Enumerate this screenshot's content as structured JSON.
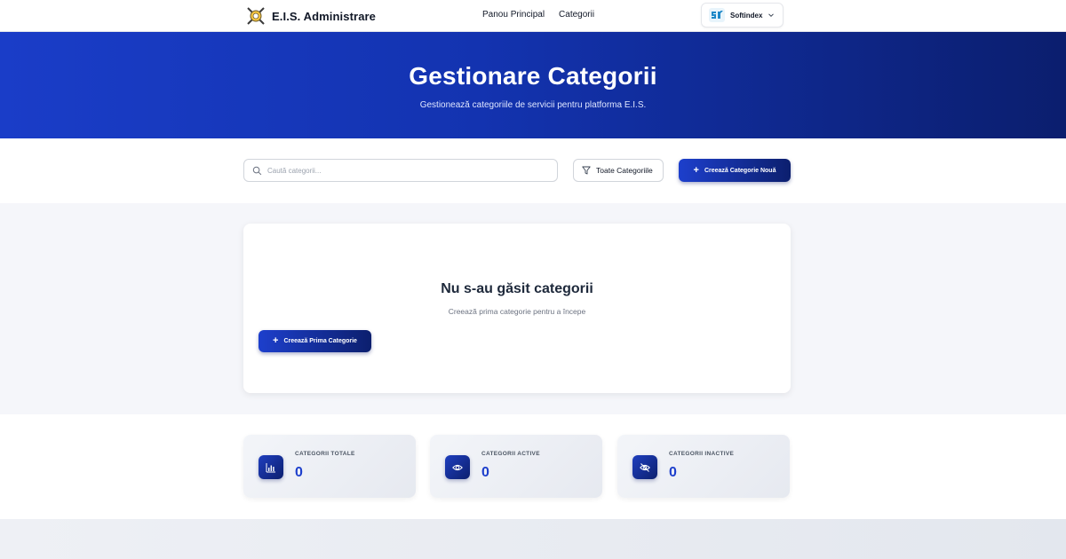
{
  "nav": {
    "brand_name": "E.I.S. Administrare",
    "brand_icon": "crossed-tools-logo-icon",
    "links": [
      {
        "label": "Panou Principal"
      },
      {
        "label": "Categorii"
      }
    ],
    "company": {
      "name": "Softindex",
      "logo_icon": "softindex-logo-icon"
    }
  },
  "hero": {
    "title": "Gestionare Categorii",
    "subtitle": "Gestionează categoriile de servicii pentru platforma E.I.S."
  },
  "toolbar": {
    "search": {
      "placeholder": "Caută categorii...",
      "value": ""
    },
    "filter": {
      "selected": "Toate Categoriile"
    },
    "create_button": "Creează Categorie Nouă"
  },
  "empty_state": {
    "title": "Nu s-au găsit categorii",
    "subtitle": "Creează prima categorie pentru a începe",
    "button": "Creează Prima Categorie"
  },
  "stats": [
    {
      "label": "CATEGORII TOTALE",
      "value": "0",
      "icon": "bar-chart-icon"
    },
    {
      "label": "CATEGORII ACTIVE",
      "value": "0",
      "icon": "eye-icon"
    },
    {
      "label": "CATEGORII INACTIVE",
      "value": "0",
      "icon": "eye-off-icon"
    }
  ],
  "colors": {
    "primary": "#1d3fcc",
    "primary_dark": "#0c1f6e",
    "hero_gradient_start": "#1a3dc8",
    "hero_gradient_end": "#0b1e6e",
    "content_bg": "#f5f6fa"
  }
}
